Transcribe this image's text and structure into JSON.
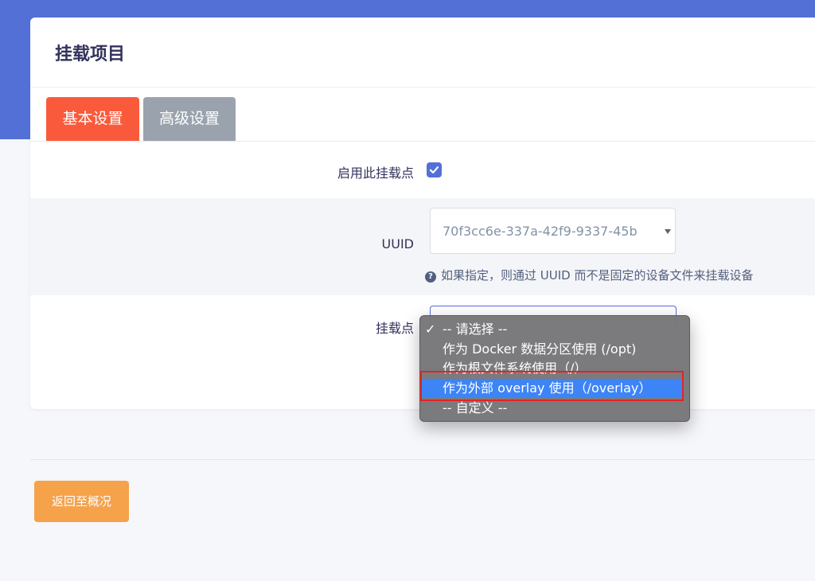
{
  "header": {
    "title": "挂载项目"
  },
  "tabs": [
    {
      "label": "基本设置",
      "active": true
    },
    {
      "label": "高级设置",
      "active": false
    }
  ],
  "form": {
    "enable": {
      "label": "启用此挂载点",
      "checked": true
    },
    "uuid": {
      "label": "UUID",
      "value": "70f3cc6e-337a-42f9-9337-45b",
      "help": "如果指定，则通过 UUID 而不是固定的设备文件来挂载设备"
    },
    "mountpoint": {
      "label": "挂载点",
      "options": [
        "-- 请选择 --",
        "作为 Docker 数据分区使用 (/opt)",
        "作为根文件系统使用（/）",
        "作为外部 overlay 使用（/overlay）",
        "-- 自定义 --"
      ],
      "checked_index": 0,
      "highlighted_index": 3
    }
  },
  "footer": {
    "back_label": "返回至概况"
  },
  "colors": {
    "brand": "#5370d6",
    "tab_active": "#fa5a3c",
    "tab_inactive": "#9aa3ad",
    "back_button": "#f5a24b",
    "option_highlight": "#3d84f7",
    "annotation": "#e42229"
  }
}
